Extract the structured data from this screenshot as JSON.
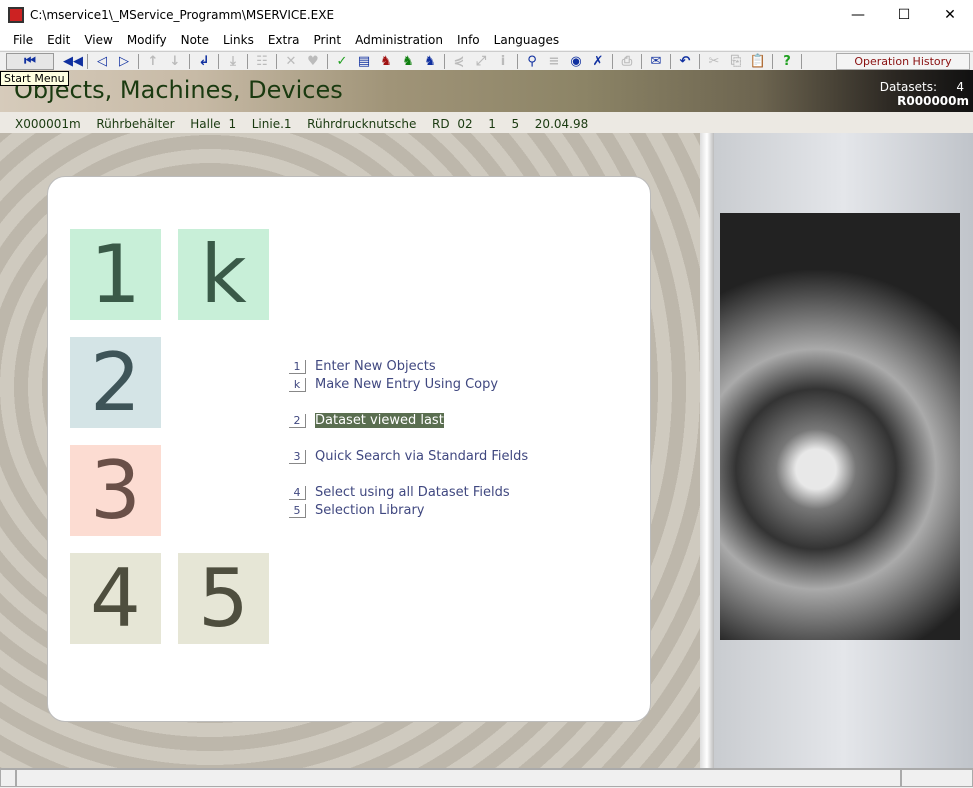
{
  "window": {
    "title": "C:\\mservice1\\_MService_Programm\\MSERVICE.EXE",
    "min": "—",
    "max": "☐",
    "close": "✕"
  },
  "menu": [
    "File",
    "Edit",
    "View",
    "Modify",
    "Note",
    "Links",
    "Extra",
    "Print",
    "Administration",
    "Info",
    "Languages"
  ],
  "toolbar": {
    "tooltip": "Start Menu",
    "operation_history": "Operation History",
    "icons": [
      {
        "name": "start-menu-icon",
        "glyph": "⏮"
      },
      {
        "name": "rewind-icon",
        "glyph": "◀◀"
      },
      {
        "name": "prev-icon",
        "glyph": "◁"
      },
      {
        "name": "next-icon",
        "glyph": "▷"
      },
      {
        "name": "arrow-up-icon",
        "glyph": "↑",
        "disabled": true
      },
      {
        "name": "arrow-down-icon",
        "glyph": "↓",
        "disabled": true
      },
      {
        "name": "return-icon",
        "glyph": "↲"
      },
      {
        "name": "import-icon",
        "glyph": "⤓",
        "disabled": true
      },
      {
        "name": "tree-icon",
        "glyph": "☷",
        "disabled": true
      },
      {
        "name": "delete-icon",
        "glyph": "✕",
        "disabled": true
      },
      {
        "name": "heart-icon",
        "glyph": "♥",
        "disabled": true
      },
      {
        "name": "check-icon",
        "glyph": "✓"
      },
      {
        "name": "form-icon",
        "glyph": "▤"
      },
      {
        "name": "squirrel-red-icon",
        "glyph": "♞"
      },
      {
        "name": "squirrel-green-icon",
        "glyph": "♞"
      },
      {
        "name": "squirrel-blue-icon",
        "glyph": "♞"
      },
      {
        "name": "share-icon",
        "glyph": "⋞",
        "disabled": true
      },
      {
        "name": "expand-icon",
        "glyph": "⤢",
        "disabled": true
      },
      {
        "name": "info-icon",
        "glyph": "i",
        "disabled": true
      },
      {
        "name": "binoculars-icon",
        "glyph": "⚲"
      },
      {
        "name": "list-icon",
        "glyph": "≡",
        "disabled": true
      },
      {
        "name": "eye-icon",
        "glyph": "◉"
      },
      {
        "name": "filter-icon",
        "glyph": "✗"
      },
      {
        "name": "print-icon",
        "glyph": "⎙",
        "disabled": true
      },
      {
        "name": "mail-icon",
        "glyph": "✉"
      },
      {
        "name": "undo-icon",
        "glyph": "↶"
      },
      {
        "name": "cut-icon",
        "glyph": "✂",
        "disabled": true
      },
      {
        "name": "copy-icon",
        "glyph": "⎘",
        "disabled": true
      },
      {
        "name": "paste-icon",
        "glyph": "📋",
        "disabled": true
      },
      {
        "name": "help-icon",
        "glyph": "?"
      }
    ]
  },
  "header": {
    "title": "Objects, Machines, Devices",
    "datasets_label": "Datasets:",
    "datasets_count": "4",
    "record": "R000000m"
  },
  "info_line": "X000001m  Rührbehälter  Halle 1  Linie.1  Rührdrucknutsche  RD 02  1  5  20.04.98",
  "tiles": [
    {
      "label": "1",
      "bg": "#c8efd8",
      "fg": "#3a5a48"
    },
    {
      "label": "k",
      "bg": "#c8efd8",
      "fg": "#3a5a48"
    },
    {
      "label": "2",
      "bg": "#d4e4e6",
      "fg": "#3e5458"
    },
    {
      "label": "3",
      "bg": "#fcdcd2",
      "fg": "#6a5048"
    },
    {
      "label": "4",
      "bg": "#e6e6d6",
      "fg": "#4e4e3e"
    },
    {
      "label": "5",
      "bg": "#e6e6d6",
      "fg": "#4e4e3e"
    }
  ],
  "options": [
    {
      "key": "1",
      "label": "Enter New Objects"
    },
    {
      "key": "k",
      "label": "Make New Entry Using Copy"
    },
    {
      "key": "2",
      "label": "Dataset viewed last",
      "selected": true
    },
    {
      "key": "3",
      "label": "Quick Search via Standard Fields"
    },
    {
      "key": "4",
      "label": "Select using all Dataset Fields"
    },
    {
      "key": "5",
      "label": "Selection Library"
    }
  ]
}
